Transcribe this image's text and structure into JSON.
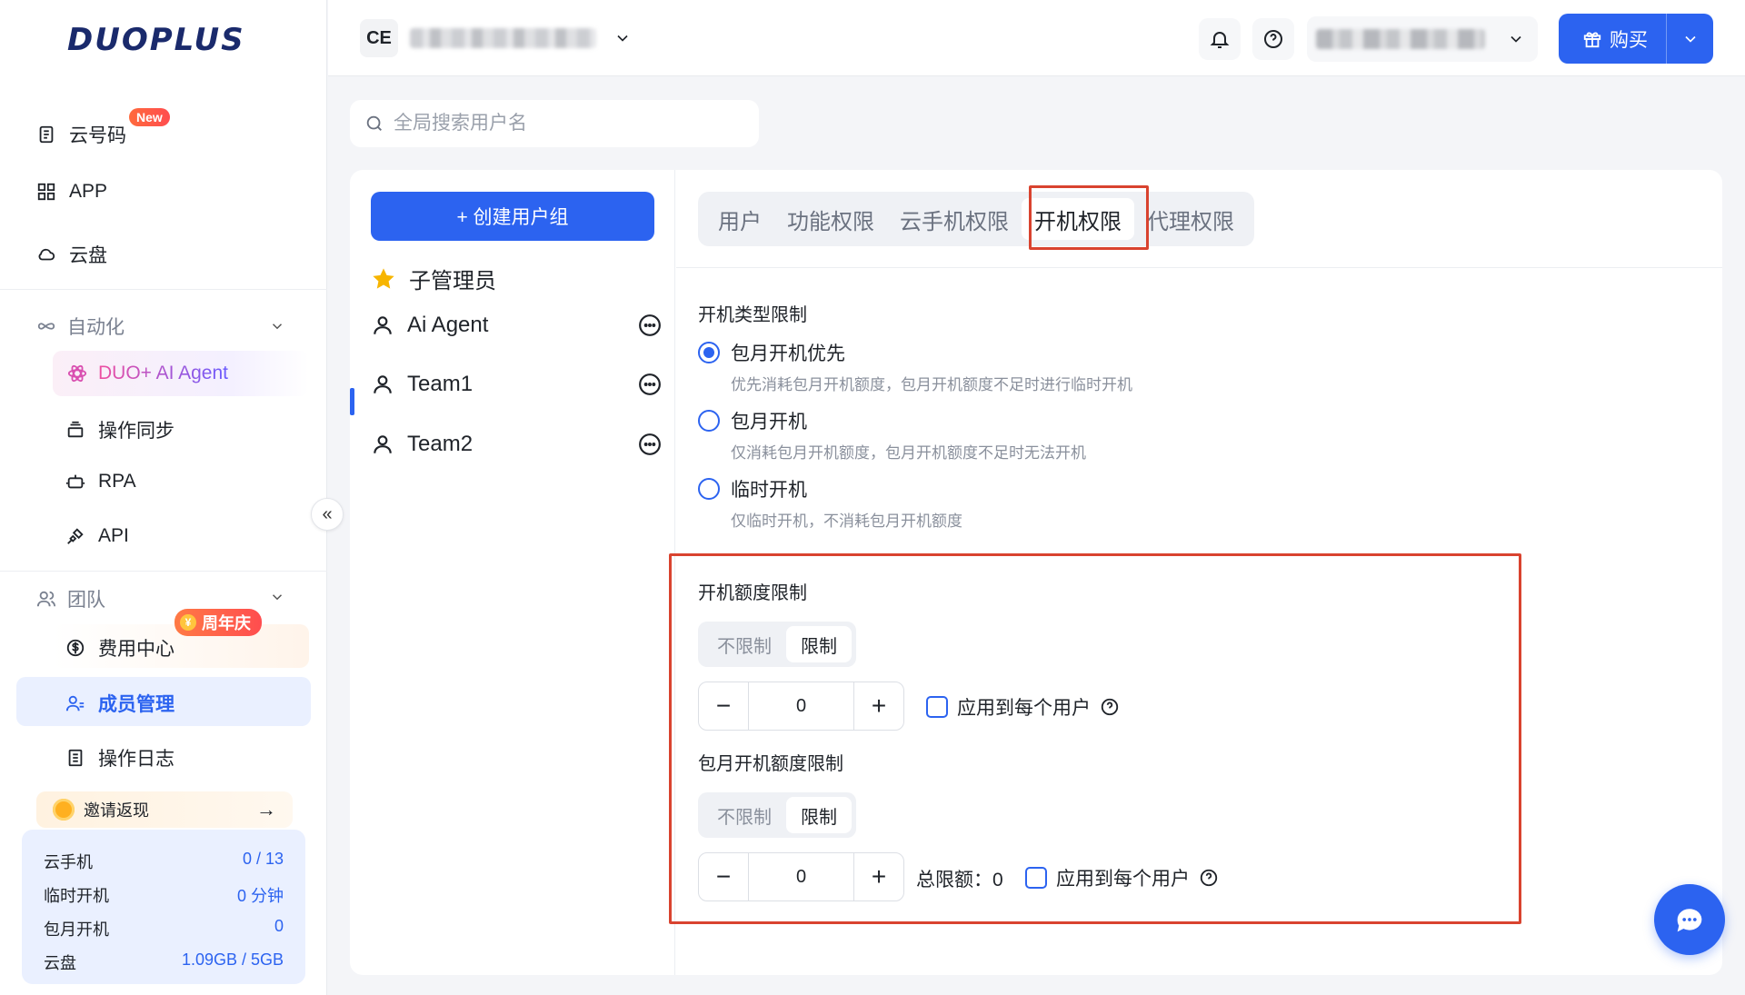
{
  "brand": {
    "logo": "DUOPLUS"
  },
  "sidebar": {
    "items": [
      {
        "label": "云号码",
        "icon": "phone-card-icon",
        "badge": "New"
      },
      {
        "label": "APP",
        "icon": "grid-icon"
      },
      {
        "label": "云盘",
        "icon": "cloud-icon"
      }
    ],
    "automation": {
      "title": "自动化",
      "icon": "infinity-icon",
      "items": [
        {
          "label": "DUO+ AI Agent",
          "icon": "ai-atom-icon"
        },
        {
          "label": "操作同步",
          "icon": "sync-stack-icon"
        },
        {
          "label": "RPA",
          "icon": "robot-icon"
        },
        {
          "label": "API",
          "icon": "plug-icon"
        }
      ]
    },
    "team": {
      "title": "团队",
      "icon": "team-icon",
      "items": [
        {
          "label": "费用中心",
          "icon": "dollar-icon",
          "badge": "周年庆"
        },
        {
          "label": "成员管理",
          "icon": "member-icon"
        },
        {
          "label": "操作日志",
          "icon": "log-icon"
        }
      ]
    },
    "invite": {
      "label": "邀请返现",
      "arrow": "→"
    },
    "stats": [
      {
        "label": "云手机",
        "value": "0 / 13"
      },
      {
        "label": "临时开机",
        "value": "0 分钟"
      },
      {
        "label": "包月开机",
        "value": "0"
      },
      {
        "label": "云盘",
        "value": "1.09GB / 5GB"
      }
    ],
    "collapse_glyph": "«"
  },
  "topbar": {
    "workspace_initials": "CE",
    "buy_label": "购买"
  },
  "search": {
    "placeholder": "全局搜索用户名"
  },
  "groups": {
    "create_label": "+ 创建用户组",
    "admin_label": "子管理员",
    "items": [
      {
        "name": "Ai Agent"
      },
      {
        "name": "Team1"
      },
      {
        "name": "Team2"
      }
    ]
  },
  "tabs": [
    {
      "label": "用户"
    },
    {
      "label": "功能权限"
    },
    {
      "label": "云手机权限"
    },
    {
      "label": "开机权限"
    },
    {
      "label": "代理权限"
    }
  ],
  "boot_type": {
    "title": "开机类型限制",
    "options": [
      {
        "label": "包月开机优先",
        "desc": "优先消耗包月开机额度，包月开机额度不足时进行临时开机",
        "selected": true
      },
      {
        "label": "包月开机",
        "desc": "仅消耗包月开机额度，包月开机额度不足时无法开机",
        "selected": false
      },
      {
        "label": "临时开机",
        "desc": "仅临时开机，不消耗包月开机额度",
        "selected": false
      }
    ]
  },
  "boot_quota": {
    "title": "开机额度限制",
    "seg_unlimited": "不限制",
    "seg_limited": "限制",
    "value": "0",
    "apply_label": "应用到每个用户"
  },
  "monthly_quota": {
    "title": "包月开机额度限制",
    "seg_unlimited": "不限制",
    "seg_limited": "限制",
    "value": "0",
    "total_label": "总限额：0",
    "apply_label": "应用到每个用户"
  },
  "colors": {
    "accent": "#2c63f0",
    "highlight": "#d9432f"
  }
}
